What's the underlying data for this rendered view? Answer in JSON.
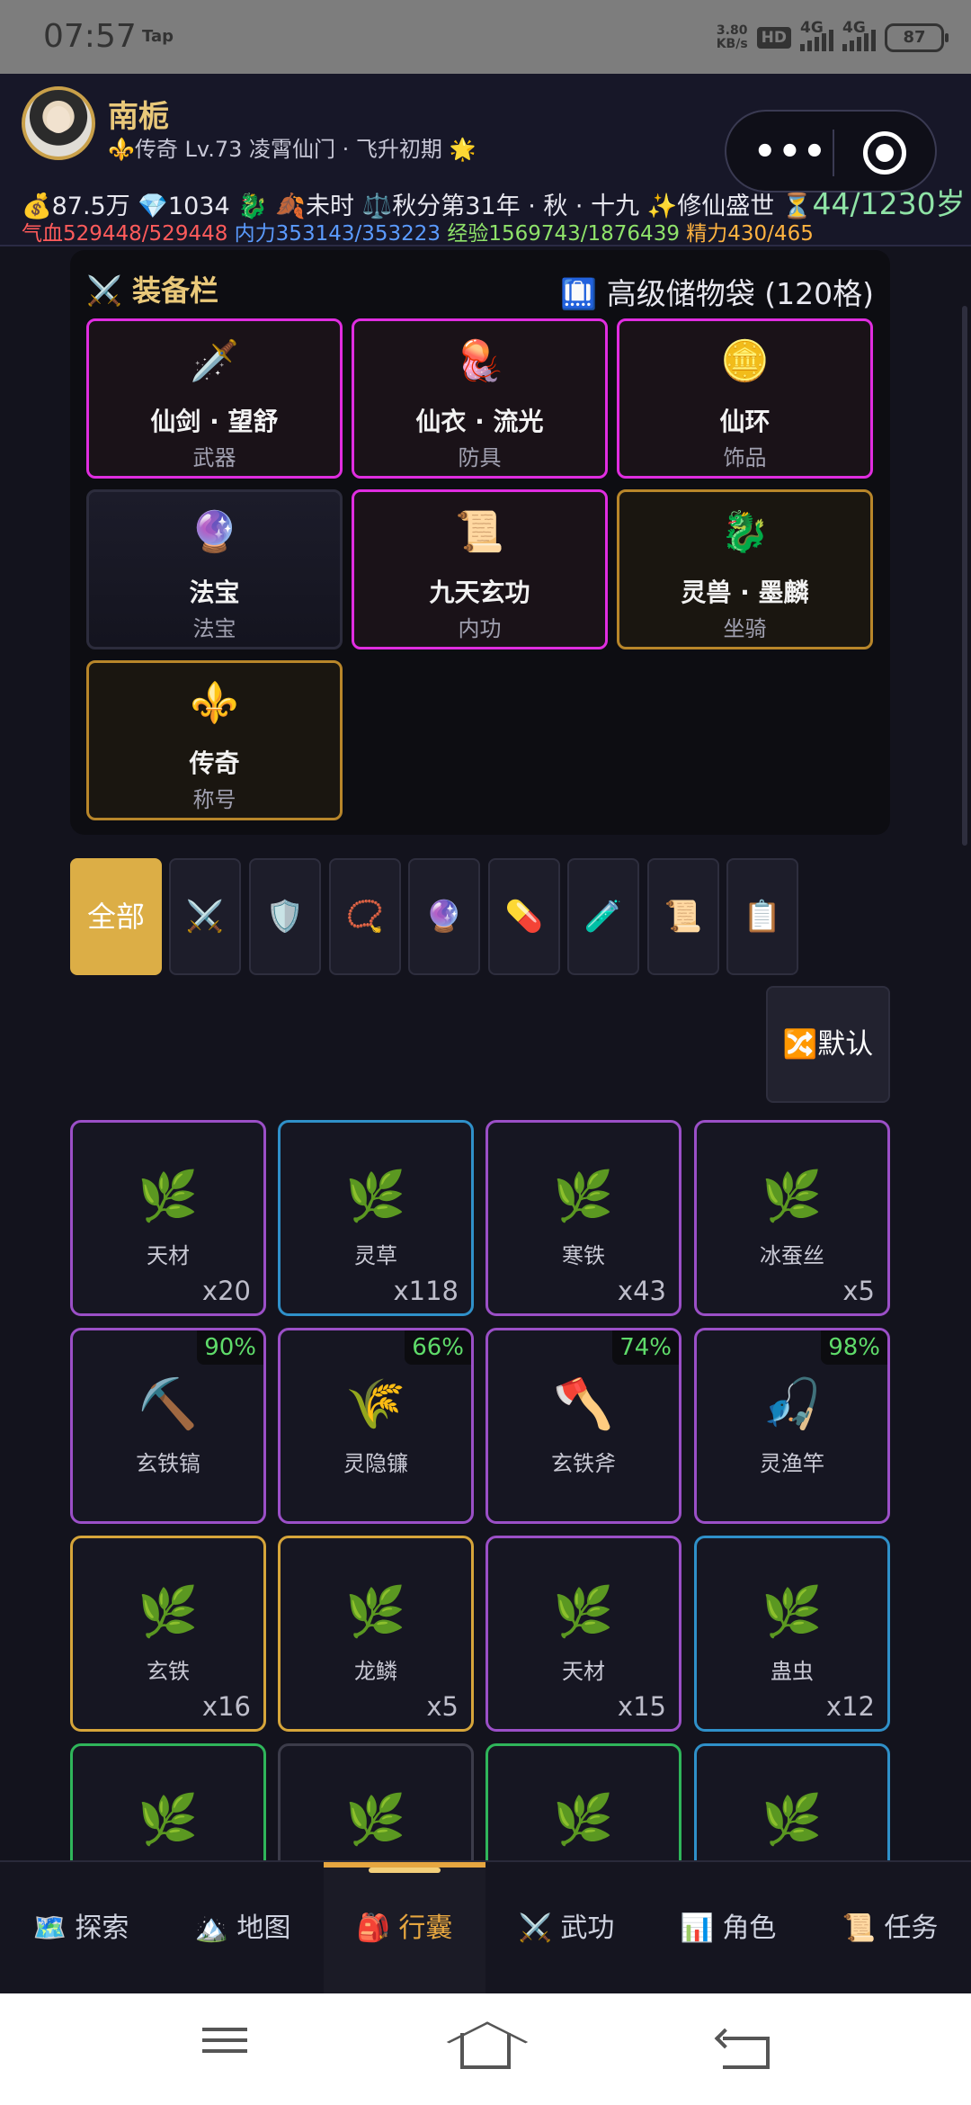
{
  "status_bar": {
    "time": "07:57",
    "tap": "Tap",
    "speed": "3.80\nKB/s",
    "hd": "HD",
    "net1": "4G",
    "net2": "4G",
    "battery": "87"
  },
  "header": {
    "name": "南栀",
    "subtitle": "⚜️传奇 Lv.73 凌霄仙门 · 飞升初期 🌟",
    "capsule_more": "•••",
    "stats_line1_prefix": "💰87.5万 💎1034 🐉 🍂未时 ⚖️秋分第31年 · 秋 · 十九 ✨修仙盛世 ⏳",
    "age": "44/1230岁",
    "hp_label": "气血",
    "hp_value": "529448/529448",
    "mp_label": "内力",
    "mp_value": "353143/353223",
    "exp_label": "经验",
    "exp_value": "1569743/1876439",
    "energy_label": "精力",
    "energy_value": "430/465"
  },
  "equipment": {
    "title": "⚔️ 装备栏",
    "bag": "🛄 高级储物袋 (120格)",
    "slots": [
      {
        "icon": "🗡️",
        "name": "仙剑 · 望舒",
        "type": "武器"
      },
      {
        "icon": "🪼",
        "name": "仙衣 · 流光",
        "type": "防具"
      },
      {
        "icon": "🪙",
        "name": "仙环",
        "type": "饰品"
      },
      {
        "icon": "🔮",
        "name": "法宝",
        "type": "法宝"
      },
      {
        "icon": "📜",
        "name": "九天玄功",
        "type": "内功"
      },
      {
        "icon": "🐉",
        "name": "灵兽 · 墨麟",
        "type": "坐骑"
      },
      {
        "icon": "⚜️",
        "name": "传奇",
        "type": "称号"
      }
    ]
  },
  "filters": {
    "all": "全部",
    "icons": [
      "⚔️",
      "🛡️",
      "📿",
      "🔮",
      "💊",
      "🧪",
      "📜",
      "📋"
    ]
  },
  "sort_button": "🔀默认",
  "items": [
    {
      "icon": "🌿",
      "name": "天材",
      "qty": "x20",
      "dur": ""
    },
    {
      "icon": "🌿",
      "name": "灵草",
      "qty": "x118",
      "dur": ""
    },
    {
      "icon": "🌿",
      "name": "寒铁",
      "qty": "x43",
      "dur": ""
    },
    {
      "icon": "🌿",
      "name": "冰蚕丝",
      "qty": "x5",
      "dur": ""
    },
    {
      "icon": "⛏️",
      "name": "玄铁镐",
      "qty": "",
      "dur": "90%"
    },
    {
      "icon": "🌾",
      "name": "灵隐镰",
      "qty": "",
      "dur": "66%"
    },
    {
      "icon": "🪓",
      "name": "玄铁斧",
      "qty": "",
      "dur": "74%"
    },
    {
      "icon": "🎣",
      "name": "灵渔竿",
      "qty": "",
      "dur": "98%"
    },
    {
      "icon": "🌿",
      "name": "玄铁",
      "qty": "x16",
      "dur": ""
    },
    {
      "icon": "🌿",
      "name": "龙鳞",
      "qty": "x5",
      "dur": ""
    },
    {
      "icon": "🌿",
      "name": "天材",
      "qty": "x15",
      "dur": ""
    },
    {
      "icon": "🌿",
      "name": "蛊虫",
      "qty": "x12",
      "dur": ""
    },
    {
      "icon": "🌿",
      "name": "",
      "qty": "",
      "dur": ""
    },
    {
      "icon": "🌿",
      "name": "",
      "qty": "",
      "dur": ""
    },
    {
      "icon": "🌿",
      "name": "",
      "qty": "",
      "dur": ""
    },
    {
      "icon": "🌿",
      "name": "",
      "qty": "",
      "dur": ""
    }
  ],
  "bottom_nav": [
    {
      "label": "🗺️ 探索"
    },
    {
      "label": "🏔️ 地图"
    },
    {
      "label": "🎒 行囊"
    },
    {
      "label": "⚔️ 武功"
    },
    {
      "label": "📊 角色"
    },
    {
      "label": "📜 任务"
    }
  ]
}
